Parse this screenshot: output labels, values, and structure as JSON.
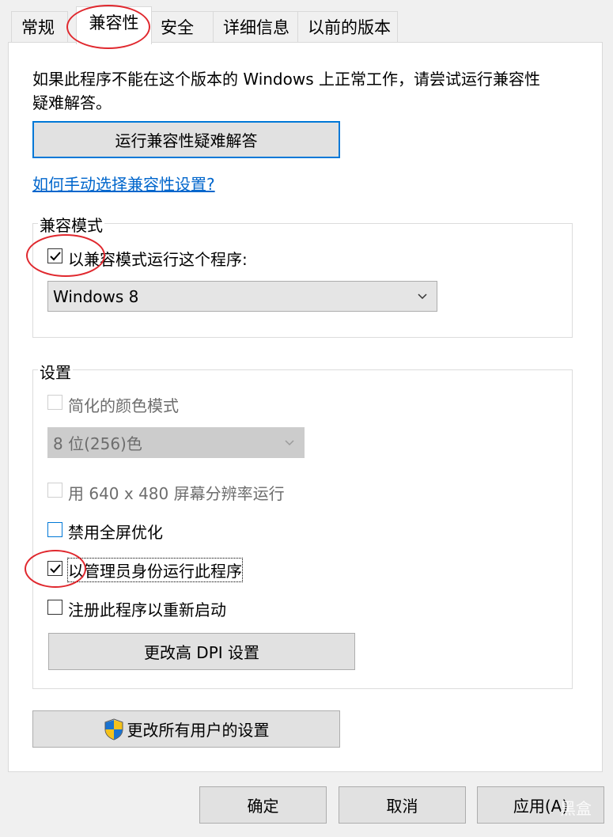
{
  "tabs": [
    {
      "label": "常规"
    },
    {
      "label": "兼容性"
    },
    {
      "label": "安全"
    },
    {
      "label": "详细信息"
    },
    {
      "label": "以前的版本"
    }
  ],
  "intro": {
    "line1": "如果此程序不能在这个版本的 Windows 上正常工作，请尝试运行兼容性",
    "line2": "疑难解答。"
  },
  "troubleshooter_button": "运行兼容性疑难解答",
  "manual_link": "如何手动选择兼容性设置?",
  "compat_mode": {
    "legend": "兼容模式",
    "checkbox_label": "以兼容模式运行这个程序:",
    "checked": true,
    "os_select": "Windows 8"
  },
  "settings": {
    "legend": "设置",
    "reduced_color_label": "简化的颜色模式",
    "color_select": "8 位(256)色",
    "resolution_label": "用 640 x 480 屏幕分辨率运行",
    "disable_fullscreen_label": "禁用全屏优化",
    "run_as_admin_label": "以管理员身份运行此程序",
    "run_as_admin_checked": true,
    "register_restart_label": "注册此程序以重新启动",
    "dpi_button": "更改高 DPI 设置"
  },
  "all_users_button": "更改所有用户的设置",
  "footer": {
    "ok": "确定",
    "cancel": "取消",
    "apply": "应用(A)"
  },
  "watermark": "黑盒",
  "colors": {
    "accent": "#0078d7",
    "annotation": "#e0282e",
    "link": "#0066cc"
  }
}
